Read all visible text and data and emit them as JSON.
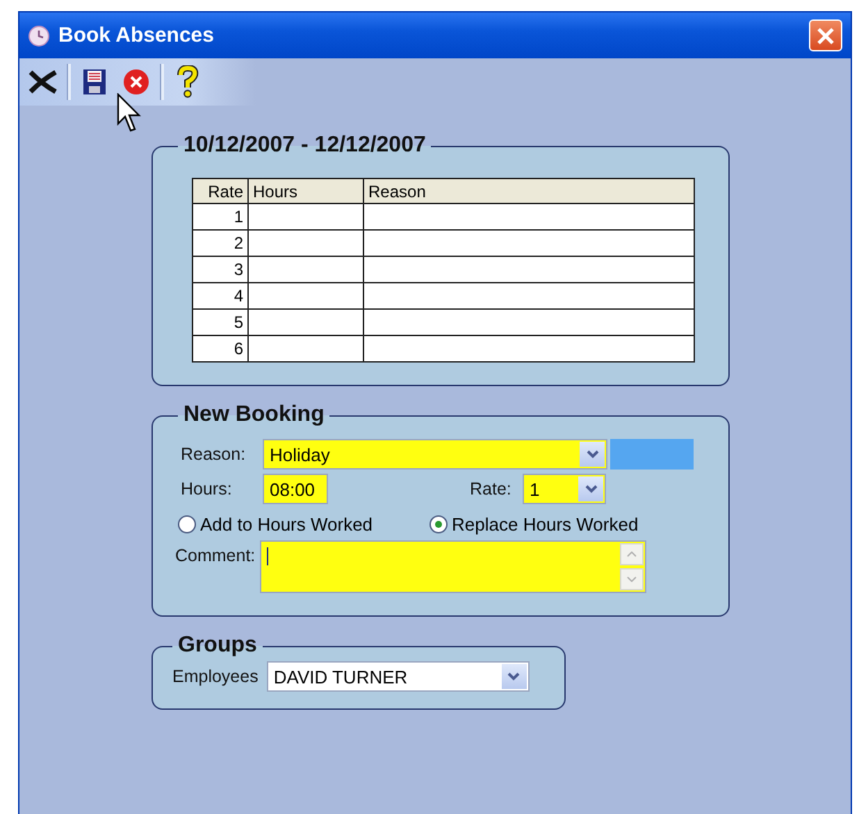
{
  "window": {
    "title": "Book Absences"
  },
  "period": {
    "title": "10/12/2007 - 12/12/2007",
    "columns": [
      "Rate",
      "Hours",
      "Reason"
    ],
    "rows": [
      {
        "rate": "1"
      },
      {
        "rate": "2"
      },
      {
        "rate": "3"
      },
      {
        "rate": "4"
      },
      {
        "rate": "5"
      },
      {
        "rate": "6"
      }
    ]
  },
  "new_booking": {
    "title": "New Booking",
    "reason": {
      "label": "Reason:",
      "value": "Holiday"
    },
    "hours": {
      "label": "Hours:",
      "value": "08:00"
    },
    "rate": {
      "label": "Rate:",
      "value": "1"
    },
    "options": [
      {
        "label": "Add to Hours Worked",
        "selected": false
      },
      {
        "label": "Replace Hours Worked",
        "selected": true
      }
    ],
    "comment": {
      "label": "Comment:"
    }
  },
  "groups": {
    "title": "Groups",
    "employees": {
      "label": "Employees",
      "value": "DAVID TURNER"
    }
  }
}
